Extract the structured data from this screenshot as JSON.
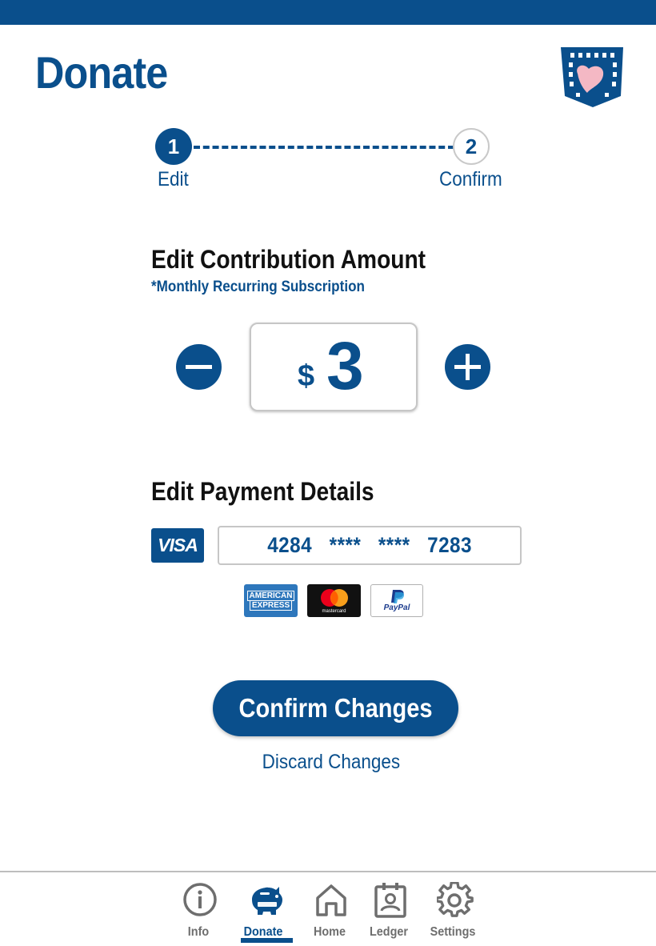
{
  "header": {
    "title": "Donate"
  },
  "stepper": {
    "steps": [
      {
        "number": "1",
        "label": "Edit",
        "active": true
      },
      {
        "number": "2",
        "label": "Confirm",
        "active": false
      }
    ]
  },
  "contribution": {
    "heading": "Edit Contribution Amount",
    "note": "*Monthly Recurring Subscription",
    "currency": "$",
    "amount": "3",
    "decrease_icon": "minus-icon",
    "increase_icon": "plus-icon"
  },
  "payment": {
    "heading": "Edit Payment Details",
    "card_brand": "VISA",
    "card_number": "4284   ****   ****   7283",
    "accepted_methods": {
      "amex_line1": "AMERICAN",
      "amex_line2": "EXPRESS",
      "mastercard": "mastercard",
      "paypal": "PayPal"
    }
  },
  "actions": {
    "confirm_label": "Confirm Changes",
    "discard_label": "Discard Changes"
  },
  "nav": {
    "items": [
      {
        "label": "Info",
        "icon": "info-icon"
      },
      {
        "label": "Donate",
        "icon": "piggy-bank-icon",
        "active": true
      },
      {
        "label": "Home",
        "icon": "home-icon"
      },
      {
        "label": "Ledger",
        "icon": "ledger-icon"
      },
      {
        "label": "Settings",
        "icon": "gear-icon"
      }
    ]
  },
  "colors": {
    "brand": "#0a4f8c",
    "inactive_nav": "#6e6e6e",
    "logo_heart": "#f4b8c4"
  }
}
